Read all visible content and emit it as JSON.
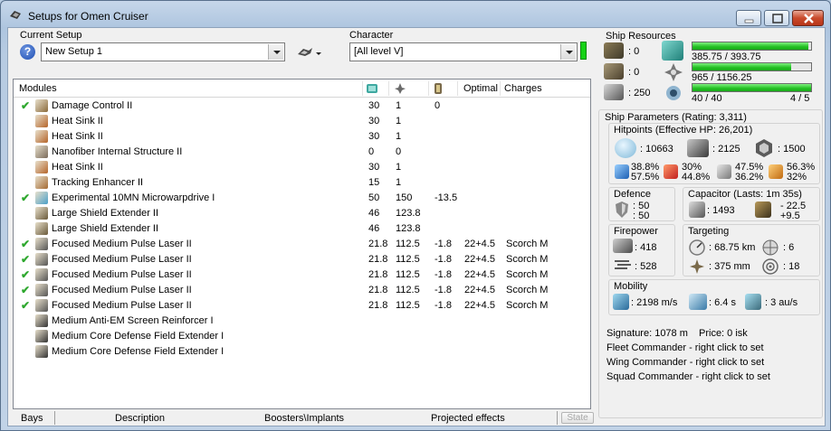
{
  "window": {
    "title": "Setups for Omen Cruiser"
  },
  "setup": {
    "label": "Current Setup",
    "value": "New Setup 1"
  },
  "character": {
    "label": "Character",
    "value": "[All level V]"
  },
  "modules_table": {
    "headers": {
      "modules": "Modules",
      "optimal": "Optimal",
      "charges": "Charges"
    },
    "rows": [
      {
        "checked": true,
        "icon": "damage-control-icon",
        "name": "Damage Control II",
        "cpu": "30",
        "pg": "1",
        "cap": "0",
        "optimal": "",
        "charges": "",
        "color": "#8a6a3a"
      },
      {
        "checked": false,
        "icon": "heat-sink-icon",
        "name": "Heat Sink II",
        "cpu": "30",
        "pg": "1",
        "cap": "",
        "optimal": "",
        "charges": "",
        "color": "#b5652a"
      },
      {
        "checked": false,
        "icon": "heat-sink-icon",
        "name": "Heat Sink II",
        "cpu": "30",
        "pg": "1",
        "cap": "",
        "optimal": "",
        "charges": "",
        "color": "#b5652a"
      },
      {
        "checked": false,
        "icon": "nanofiber-icon",
        "name": "Nanofiber Internal Structure II",
        "cpu": "0",
        "pg": "0",
        "cap": "",
        "optimal": "",
        "charges": "",
        "color": "#7a6a5a"
      },
      {
        "checked": false,
        "icon": "heat-sink-icon",
        "name": "Heat Sink II",
        "cpu": "30",
        "pg": "1",
        "cap": "",
        "optimal": "",
        "charges": "",
        "color": "#b5652a"
      },
      {
        "checked": false,
        "icon": "tracking-enhancer-icon",
        "name": "Tracking Enhancer II",
        "cpu": "15",
        "pg": "1",
        "cap": "",
        "optimal": "",
        "charges": "",
        "color": "#a56a32"
      },
      {
        "checked": true,
        "icon": "microwarpdrive-icon",
        "name": "Experimental 10MN Microwarpdrive I",
        "cpu": "50",
        "pg": "150",
        "cap": "-13.5",
        "optimal": "",
        "charges": "",
        "color": "#4aa0c8"
      },
      {
        "checked": false,
        "icon": "shield-extender-icon",
        "name": "Large Shield Extender II",
        "cpu": "46",
        "pg": "123.8",
        "cap": "",
        "optimal": "",
        "charges": "",
        "color": "#6a5a3a"
      },
      {
        "checked": false,
        "icon": "shield-extender-icon",
        "name": "Large Shield Extender II",
        "cpu": "46",
        "pg": "123.8",
        "cap": "",
        "optimal": "",
        "charges": "",
        "color": "#6a5a3a"
      },
      {
        "checked": true,
        "icon": "pulse-laser-icon",
        "name": "Focused Medium Pulse Laser II",
        "cpu": "21.8",
        "pg": "112.5",
        "cap": "-1.8",
        "optimal": "22+4.5",
        "charges": "Scorch M",
        "color": "#555"
      },
      {
        "checked": true,
        "icon": "pulse-laser-icon",
        "name": "Focused Medium Pulse Laser II",
        "cpu": "21.8",
        "pg": "112.5",
        "cap": "-1.8",
        "optimal": "22+4.5",
        "charges": "Scorch M",
        "color": "#555"
      },
      {
        "checked": true,
        "icon": "pulse-laser-icon",
        "name": "Focused Medium Pulse Laser II",
        "cpu": "21.8",
        "pg": "112.5",
        "cap": "-1.8",
        "optimal": "22+4.5",
        "charges": "Scorch M",
        "color": "#555"
      },
      {
        "checked": true,
        "icon": "pulse-laser-icon",
        "name": "Focused Medium Pulse Laser II",
        "cpu": "21.8",
        "pg": "112.5",
        "cap": "-1.8",
        "optimal": "22+4.5",
        "charges": "Scorch M",
        "color": "#555"
      },
      {
        "checked": true,
        "icon": "pulse-laser-icon",
        "name": "Focused Medium Pulse Laser II",
        "cpu": "21.8",
        "pg": "112.5",
        "cap": "-1.8",
        "optimal": "22+4.5",
        "charges": "Scorch M",
        "color": "#555"
      },
      {
        "checked": false,
        "icon": "rig-icon",
        "name": "Medium Anti-EM Screen Reinforcer I",
        "cpu": "",
        "pg": "",
        "cap": "",
        "optimal": "",
        "charges": "",
        "color": "#333"
      },
      {
        "checked": false,
        "icon": "rig-icon",
        "name": "Medium Core Defense Field Extender I",
        "cpu": "",
        "pg": "",
        "cap": "",
        "optimal": "",
        "charges": "",
        "color": "#333"
      },
      {
        "checked": false,
        "icon": "rig-icon",
        "name": "Medium Core Defense Field Extender I",
        "cpu": "",
        "pg": "",
        "cap": "",
        "optimal": "",
        "charges": "",
        "color": "#333"
      }
    ]
  },
  "status_bar": {
    "bays": "Bays",
    "description": "Description",
    "boosters": "Boosters\\Implants",
    "projected": "Projected effects",
    "state": "State"
  },
  "resources": {
    "label": "Ship Resources",
    "turret_hardpoints": ": 0",
    "launcher_hardpoints": ": 0",
    "drone_bay": ": 250",
    "cpu": {
      "text": "385.75 / 393.75",
      "fraction": 0.98
    },
    "powergrid": {
      "text": "965 / 1156.25",
      "fraction": 0.835
    },
    "calibration": {
      "text": "40 / 40",
      "fraction": 1.0
    },
    "rig_slots": "4 / 5"
  },
  "parameters": {
    "label": "Ship Parameters (Rating: 3,311)",
    "hitpoints": {
      "label": "Hitpoints (Effective HP: 26,201)",
      "shield": ": 10663",
      "armor": ": 2125",
      "structure": ": 1500",
      "em": [
        "38.8%",
        "57.5%"
      ],
      "thermal": [
        "30%",
        "44.8%"
      ],
      "kinetic": [
        "47.5%",
        "36.2%"
      ],
      "explosive": [
        "56.3%",
        "32%"
      ]
    },
    "defence": {
      "label": "Defence",
      "a": ": 50",
      "b": ": 50"
    },
    "capacitor": {
      "label": "Capacitor (Lasts: 1m 35s)",
      "amount": ": 1493",
      "delta": "- 22.5",
      "recharge": "+9.5"
    },
    "firepower": {
      "label": "Firepower",
      "dps": ": 418",
      "volley": ": 528"
    },
    "targeting": {
      "label": "Targeting",
      "range": ": 68.75 km",
      "targets": ": 6",
      "resolution": ": 375 mm",
      "sensor": ": 18"
    },
    "mobility": {
      "label": "Mobility",
      "speed": ": 2198 m/s",
      "align": ": 6.4 s",
      "warp": ": 3 au/s"
    }
  },
  "footer": {
    "signature": "Signature: 1078 m",
    "price": "Price: 0 isk",
    "fleet": "Fleet Commander - right click to set",
    "wing": "Wing Commander - right click to set",
    "squad": "Squad Commander - right click to set"
  }
}
